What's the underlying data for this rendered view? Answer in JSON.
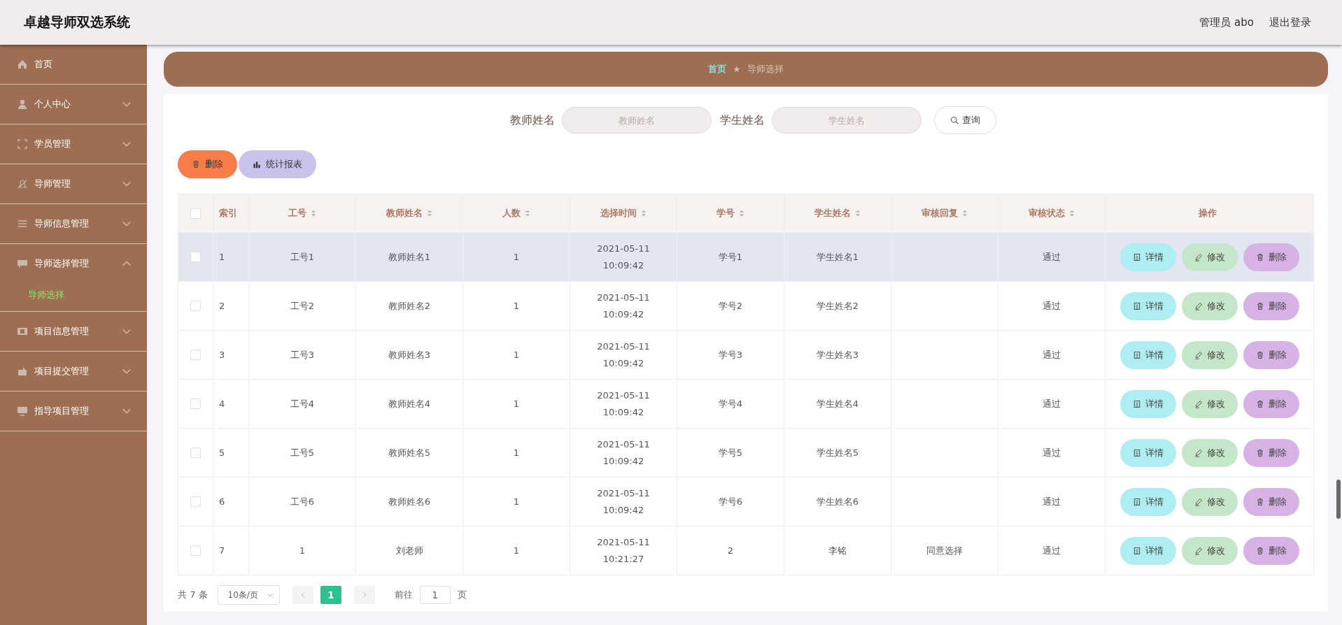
{
  "header": {
    "title": "卓越导师双选系统",
    "user": "管理员 abo",
    "logout": "退出登录"
  },
  "sidebar": {
    "items": [
      {
        "label": "首页"
      },
      {
        "label": "个人中心",
        "expanded": false
      },
      {
        "label": "学员管理",
        "expanded": false
      },
      {
        "label": "导师管理",
        "expanded": false
      },
      {
        "label": "导师信息管理",
        "expanded": false
      },
      {
        "label": "导师选择管理",
        "expanded": true,
        "children": [
          {
            "label": "导师选择",
            "selected": true
          }
        ]
      },
      {
        "label": "项目信息管理",
        "expanded": false
      },
      {
        "label": "项目提交管理",
        "expanded": false
      },
      {
        "label": "指导项目管理",
        "expanded": false
      }
    ]
  },
  "breadcrumb": [
    "首页",
    "导师选择"
  ],
  "search": {
    "fields": [
      {
        "label": "教师姓名",
        "placeholder": "教师姓名"
      },
      {
        "label": "学生姓名",
        "placeholder": "学生姓名"
      }
    ],
    "button": "查询"
  },
  "actions": [
    {
      "kind": "delete",
      "label": "删除"
    },
    {
      "kind": "report",
      "label": "统计报表"
    }
  ],
  "table": {
    "all_checked": false,
    "columns": [
      {
        "label": "索引",
        "sortable": false
      },
      {
        "label": "工号",
        "sortable": true
      },
      {
        "label": "教师姓名",
        "sortable": true
      },
      {
        "label": "人数",
        "sortable": true
      },
      {
        "label": "选择时间",
        "sortable": true
      },
      {
        "label": "学号",
        "sortable": true
      },
      {
        "label": "学生姓名",
        "sortable": true
      },
      {
        "label": "审核回复",
        "sortable": true
      },
      {
        "label": "审核状态",
        "sortable": true
      },
      {
        "label": "操作",
        "sortable": false
      }
    ],
    "rows": [
      {
        "hovered": true,
        "checked": false,
        "cells": [
          "1",
          "工号1",
          "教师姓名1",
          "1",
          "2021-05-11 10:09:42",
          "学号1",
          "学生姓名1",
          "",
          "通过"
        ],
        "actions": [
          {
            "kind": "detail",
            "label": "详情"
          },
          {
            "kind": "edit",
            "label": "修改"
          },
          {
            "kind": "delete",
            "label": "删除"
          }
        ]
      },
      {
        "hovered": false,
        "checked": false,
        "cells": [
          "2",
          "工号2",
          "教师姓名2",
          "1",
          "2021-05-11 10:09:42",
          "学号2",
          "学生姓名2",
          "",
          "通过"
        ],
        "actions": [
          {
            "kind": "detail",
            "label": "详情"
          },
          {
            "kind": "edit",
            "label": "修改"
          },
          {
            "kind": "delete",
            "label": "删除"
          }
        ]
      },
      {
        "hovered": false,
        "checked": false,
        "cells": [
          "3",
          "工号3",
          "教师姓名3",
          "1",
          "2021-05-11 10:09:42",
          "学号3",
          "学生姓名3",
          "",
          "通过"
        ],
        "actions": [
          {
            "kind": "detail",
            "label": "详情"
          },
          {
            "kind": "edit",
            "label": "修改"
          },
          {
            "kind": "delete",
            "label": "删除"
          }
        ]
      },
      {
        "hovered": false,
        "checked": false,
        "cells": [
          "4",
          "工号4",
          "教师姓名4",
          "1",
          "2021-05-11 10:09:42",
          "学号4",
          "学生姓名4",
          "",
          "通过"
        ],
        "actions": [
          {
            "kind": "detail",
            "label": "详情"
          },
          {
            "kind": "edit",
            "label": "修改"
          },
          {
            "kind": "delete",
            "label": "删除"
          }
        ]
      },
      {
        "hovered": false,
        "checked": false,
        "cells": [
          "5",
          "工号5",
          "教师姓名5",
          "1",
          "2021-05-11 10:09:42",
          "学号5",
          "学生姓名5",
          "",
          "通过"
        ],
        "actions": [
          {
            "kind": "detail",
            "label": "详情"
          },
          {
            "kind": "edit",
            "label": "修改"
          },
          {
            "kind": "delete",
            "label": "删除"
          }
        ]
      },
      {
        "hovered": false,
        "checked": false,
        "cells": [
          "6",
          "工号6",
          "教师姓名6",
          "1",
          "2021-05-11 10:09:42",
          "学号6",
          "学生姓名6",
          "",
          "通过"
        ],
        "actions": [
          {
            "kind": "detail",
            "label": "详情"
          },
          {
            "kind": "edit",
            "label": "修改"
          },
          {
            "kind": "delete",
            "label": "删除"
          }
        ]
      },
      {
        "hovered": false,
        "checked": false,
        "cells": [
          "7",
          "1",
          "刘老师",
          "1",
          "2021-05-11 10:21:27",
          "2",
          "李铭",
          "同意选择",
          "通过"
        ],
        "actions": [
          {
            "kind": "detail",
            "label": "详情"
          },
          {
            "kind": "edit",
            "label": "修改"
          },
          {
            "kind": "delete",
            "label": "删除"
          }
        ]
      }
    ]
  },
  "pagination": {
    "total": "共 7 条",
    "page_size": "10条/页",
    "pages": [
      {
        "label": "1",
        "selected": true
      }
    ],
    "goto_label": "前往",
    "goto_value": "1",
    "goto_suffix": "页"
  }
}
